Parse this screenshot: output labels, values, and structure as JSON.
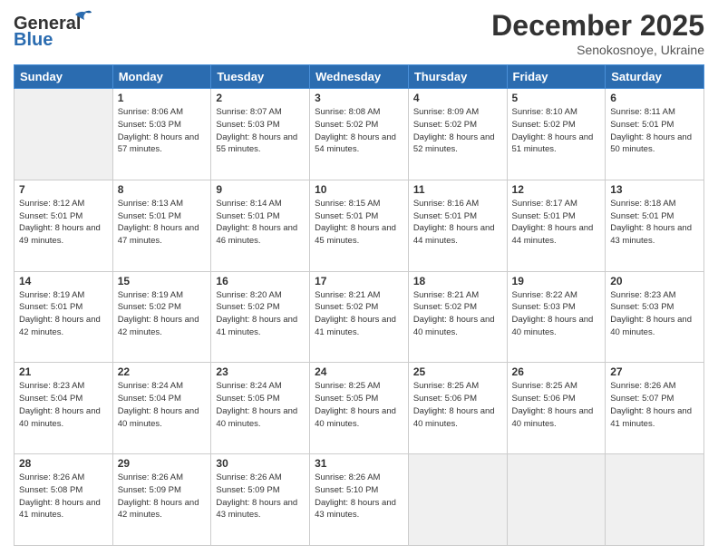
{
  "header": {
    "logo_general": "General",
    "logo_blue": "Blue",
    "month_title": "December 2025",
    "subtitle": "Senokosnoye, Ukraine"
  },
  "weekdays": [
    "Sunday",
    "Monday",
    "Tuesday",
    "Wednesday",
    "Thursday",
    "Friday",
    "Saturday"
  ],
  "weeks": [
    [
      {
        "day": "",
        "info": ""
      },
      {
        "day": "1",
        "info": "Sunrise: 8:06 AM\nSunset: 5:03 PM\nDaylight: 8 hours\nand 57 minutes."
      },
      {
        "day": "2",
        "info": "Sunrise: 8:07 AM\nSunset: 5:03 PM\nDaylight: 8 hours\nand 55 minutes."
      },
      {
        "day": "3",
        "info": "Sunrise: 8:08 AM\nSunset: 5:02 PM\nDaylight: 8 hours\nand 54 minutes."
      },
      {
        "day": "4",
        "info": "Sunrise: 8:09 AM\nSunset: 5:02 PM\nDaylight: 8 hours\nand 52 minutes."
      },
      {
        "day": "5",
        "info": "Sunrise: 8:10 AM\nSunset: 5:02 PM\nDaylight: 8 hours\nand 51 minutes."
      },
      {
        "day": "6",
        "info": "Sunrise: 8:11 AM\nSunset: 5:01 PM\nDaylight: 8 hours\nand 50 minutes."
      }
    ],
    [
      {
        "day": "7",
        "info": "Sunrise: 8:12 AM\nSunset: 5:01 PM\nDaylight: 8 hours\nand 49 minutes."
      },
      {
        "day": "8",
        "info": "Sunrise: 8:13 AM\nSunset: 5:01 PM\nDaylight: 8 hours\nand 47 minutes."
      },
      {
        "day": "9",
        "info": "Sunrise: 8:14 AM\nSunset: 5:01 PM\nDaylight: 8 hours\nand 46 minutes."
      },
      {
        "day": "10",
        "info": "Sunrise: 8:15 AM\nSunset: 5:01 PM\nDaylight: 8 hours\nand 45 minutes."
      },
      {
        "day": "11",
        "info": "Sunrise: 8:16 AM\nSunset: 5:01 PM\nDaylight: 8 hours\nand 44 minutes."
      },
      {
        "day": "12",
        "info": "Sunrise: 8:17 AM\nSunset: 5:01 PM\nDaylight: 8 hours\nand 44 minutes."
      },
      {
        "day": "13",
        "info": "Sunrise: 8:18 AM\nSunset: 5:01 PM\nDaylight: 8 hours\nand 43 minutes."
      }
    ],
    [
      {
        "day": "14",
        "info": "Sunrise: 8:19 AM\nSunset: 5:01 PM\nDaylight: 8 hours\nand 42 minutes."
      },
      {
        "day": "15",
        "info": "Sunrise: 8:19 AM\nSunset: 5:02 PM\nDaylight: 8 hours\nand 42 minutes."
      },
      {
        "day": "16",
        "info": "Sunrise: 8:20 AM\nSunset: 5:02 PM\nDaylight: 8 hours\nand 41 minutes."
      },
      {
        "day": "17",
        "info": "Sunrise: 8:21 AM\nSunset: 5:02 PM\nDaylight: 8 hours\nand 41 minutes."
      },
      {
        "day": "18",
        "info": "Sunrise: 8:21 AM\nSunset: 5:02 PM\nDaylight: 8 hours\nand 40 minutes."
      },
      {
        "day": "19",
        "info": "Sunrise: 8:22 AM\nSunset: 5:03 PM\nDaylight: 8 hours\nand 40 minutes."
      },
      {
        "day": "20",
        "info": "Sunrise: 8:23 AM\nSunset: 5:03 PM\nDaylight: 8 hours\nand 40 minutes."
      }
    ],
    [
      {
        "day": "21",
        "info": "Sunrise: 8:23 AM\nSunset: 5:04 PM\nDaylight: 8 hours\nand 40 minutes."
      },
      {
        "day": "22",
        "info": "Sunrise: 8:24 AM\nSunset: 5:04 PM\nDaylight: 8 hours\nand 40 minutes."
      },
      {
        "day": "23",
        "info": "Sunrise: 8:24 AM\nSunset: 5:05 PM\nDaylight: 8 hours\nand 40 minutes."
      },
      {
        "day": "24",
        "info": "Sunrise: 8:25 AM\nSunset: 5:05 PM\nDaylight: 8 hours\nand 40 minutes."
      },
      {
        "day": "25",
        "info": "Sunrise: 8:25 AM\nSunset: 5:06 PM\nDaylight: 8 hours\nand 40 minutes."
      },
      {
        "day": "26",
        "info": "Sunrise: 8:25 AM\nSunset: 5:06 PM\nDaylight: 8 hours\nand 40 minutes."
      },
      {
        "day": "27",
        "info": "Sunrise: 8:26 AM\nSunset: 5:07 PM\nDaylight: 8 hours\nand 41 minutes."
      }
    ],
    [
      {
        "day": "28",
        "info": "Sunrise: 8:26 AM\nSunset: 5:08 PM\nDaylight: 8 hours\nand 41 minutes."
      },
      {
        "day": "29",
        "info": "Sunrise: 8:26 AM\nSunset: 5:09 PM\nDaylight: 8 hours\nand 42 minutes."
      },
      {
        "day": "30",
        "info": "Sunrise: 8:26 AM\nSunset: 5:09 PM\nDaylight: 8 hours\nand 43 minutes."
      },
      {
        "day": "31",
        "info": "Sunrise: 8:26 AM\nSunset: 5:10 PM\nDaylight: 8 hours\nand 43 minutes."
      },
      {
        "day": "",
        "info": ""
      },
      {
        "day": "",
        "info": ""
      },
      {
        "day": "",
        "info": ""
      }
    ]
  ]
}
